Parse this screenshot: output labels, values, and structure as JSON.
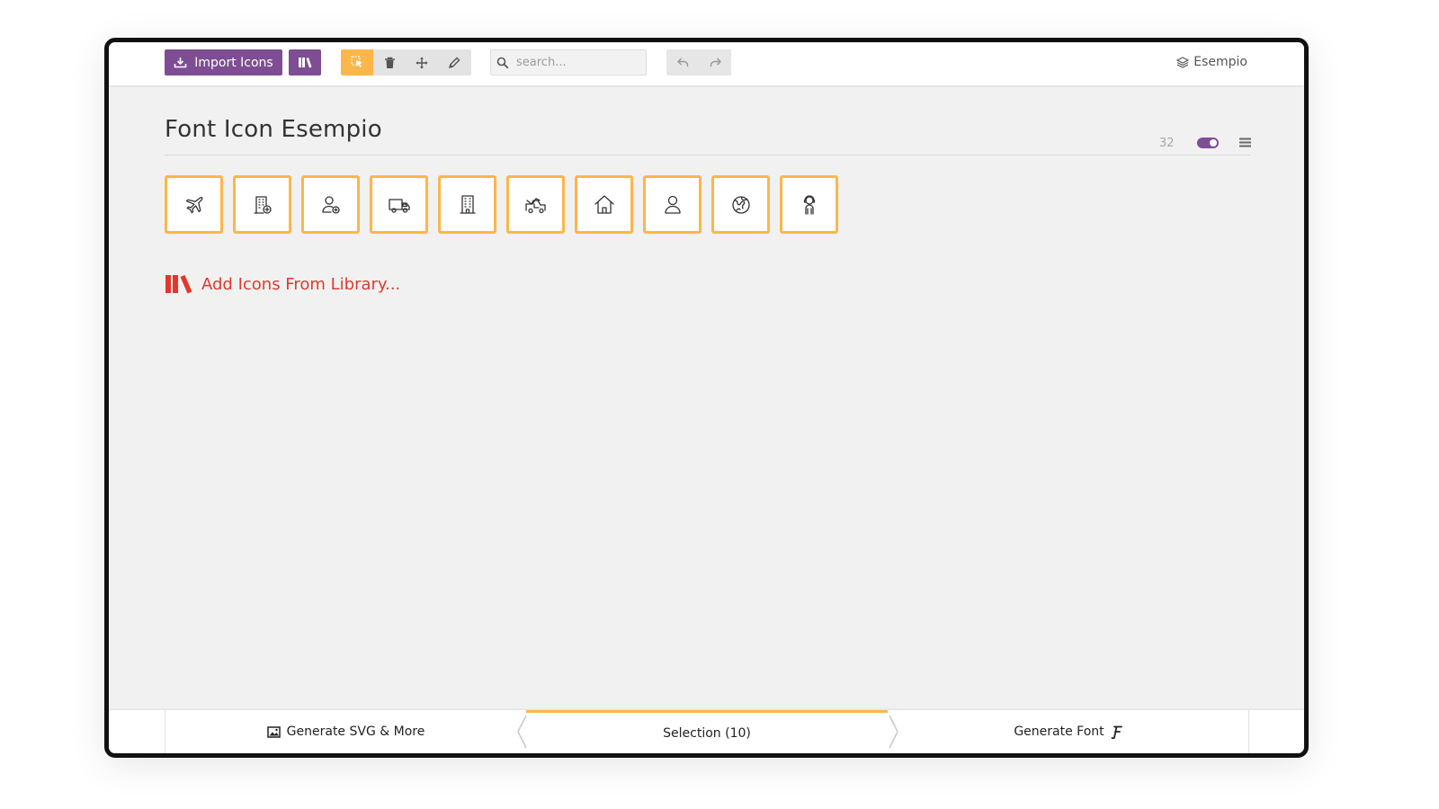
{
  "toolbar": {
    "import_label": "Import Icons",
    "search_placeholder": "search...",
    "project_name": "Esempio",
    "colors": {
      "primary": "#7e4d93",
      "accent": "#fdb64a"
    }
  },
  "main": {
    "title": "Font Icon Esempio",
    "icon_count": "32",
    "icons": [
      {
        "name": "airplane-icon"
      },
      {
        "name": "building-add-icon"
      },
      {
        "name": "user-add-icon"
      },
      {
        "name": "truck-icon"
      },
      {
        "name": "building-icon"
      },
      {
        "name": "tow-truck-icon"
      },
      {
        "name": "home-icon"
      },
      {
        "name": "user-icon"
      },
      {
        "name": "globe-icon"
      },
      {
        "name": "person-support-icon"
      }
    ],
    "add_library_label": "Add Icons From Library..."
  },
  "bottom": {
    "generate_svg_label": "Generate SVG & More",
    "selection_label": "Selection (10)",
    "generate_font_label": "Generate Font"
  }
}
